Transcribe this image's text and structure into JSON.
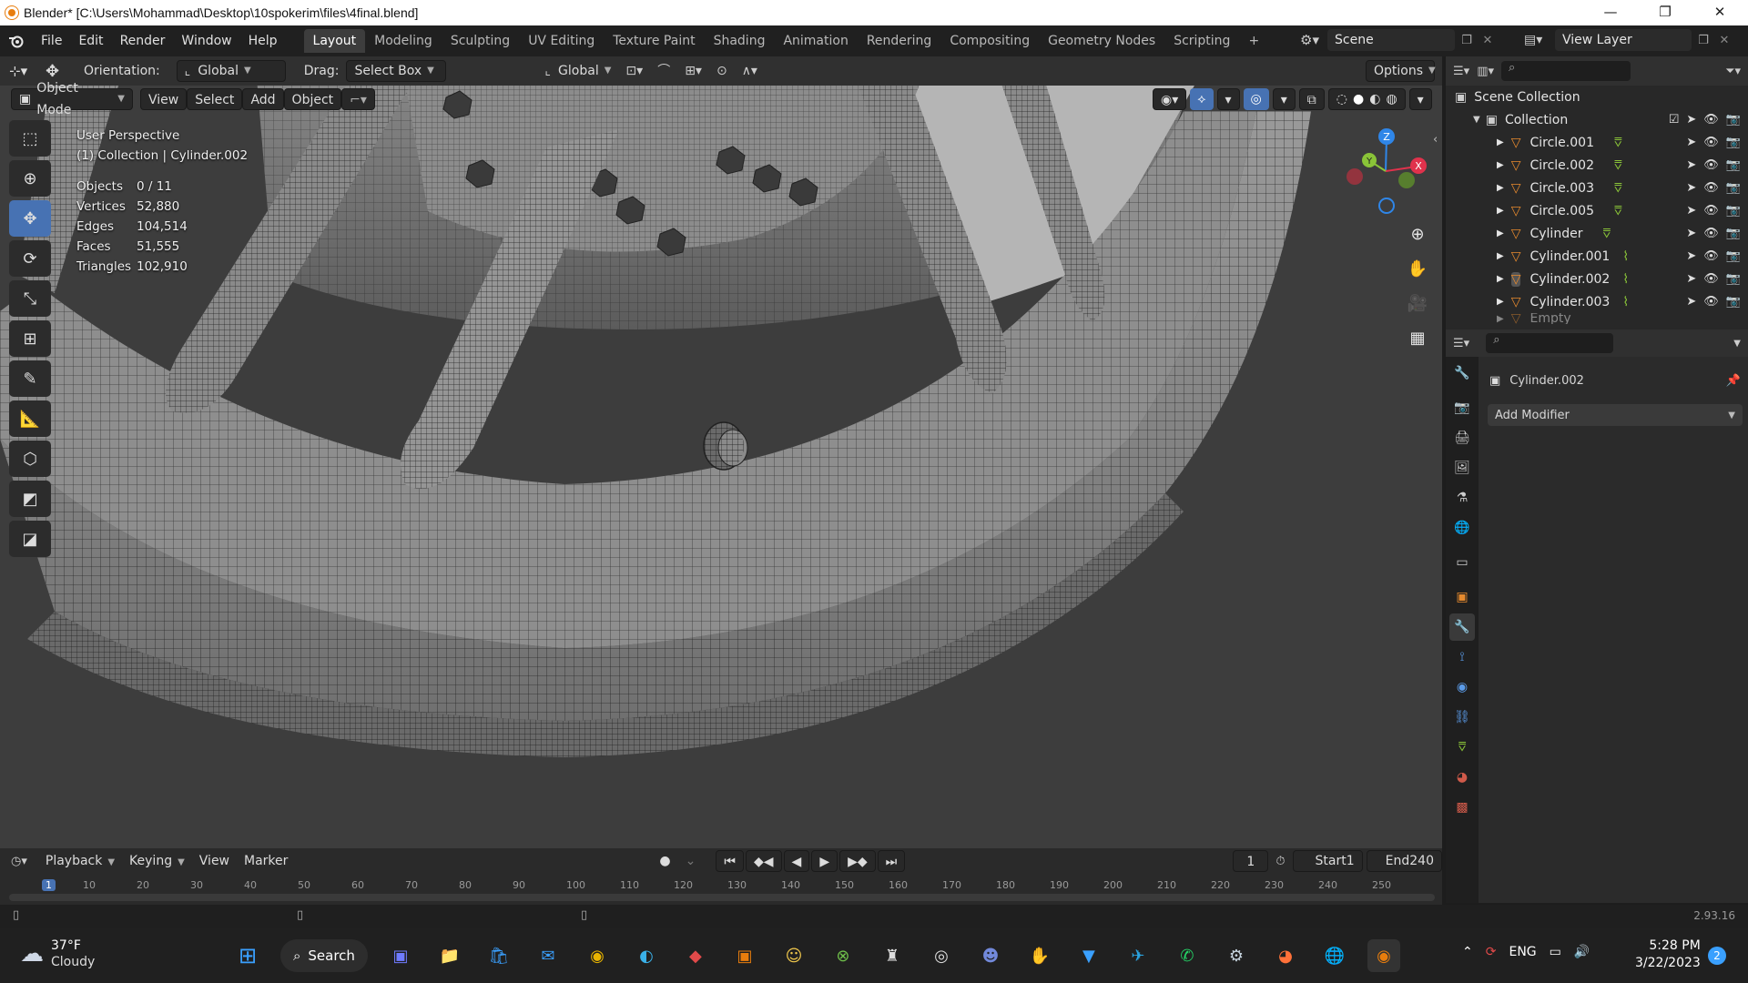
{
  "window": {
    "title": "Blender* [C:\\Users\\Mohammad\\Desktop\\10spokerim\\files\\4final.blend]",
    "minimize": "—",
    "maximize": "❐",
    "close": "✕"
  },
  "menubar": {
    "menus": [
      "File",
      "Edit",
      "Render",
      "Window",
      "Help"
    ],
    "workspaces": [
      "Layout",
      "Modeling",
      "Sculpting",
      "UV Editing",
      "Texture Paint",
      "Shading",
      "Animation",
      "Rendering",
      "Compositing",
      "Geometry Nodes",
      "Scripting"
    ],
    "active_workspace": "Layout",
    "add_tab": "+",
    "scene": "Scene",
    "view_layer": "View Layer"
  },
  "tool_header": {
    "orientation_label": "Orientation:",
    "orientation_value": "Global",
    "drag_label": "Drag:",
    "drag_value": "Select Box",
    "transform_orientation": "Global",
    "options": "Options"
  },
  "mode_header": {
    "mode": "Object Mode",
    "menus": [
      "View",
      "Select",
      "Add",
      "Object"
    ]
  },
  "viewport": {
    "perspective": "User Perspective",
    "collection_info": "(1) Collection | Cylinder.002",
    "stats": [
      {
        "key": "Objects",
        "value": "0 / 11"
      },
      {
        "key": "Vertices",
        "value": "52,880"
      },
      {
        "key": "Edges",
        "value": "104,514"
      },
      {
        "key": "Faces",
        "value": "51,555"
      },
      {
        "key": "Triangles",
        "value": "102,910"
      }
    ],
    "gizmo": {
      "x": "X",
      "y": "Y",
      "z": "Z"
    }
  },
  "outliner": {
    "scene_collection": "Scene Collection",
    "collection": "Collection",
    "items": [
      "Circle.001",
      "Circle.002",
      "Circle.003",
      "Circle.005",
      "Cylinder",
      "Cylinder.001",
      "Cylinder.002",
      "Cylinder.003",
      "Empty"
    ]
  },
  "properties": {
    "object_name": "Cylinder.002",
    "add_modifier": "Add Modifier"
  },
  "timeline": {
    "menus": [
      "Playback",
      "Keying",
      "View",
      "Marker"
    ],
    "current_frame": "1",
    "start_label": "Start",
    "start_value": "1",
    "end_label": "End",
    "end_value": "240",
    "ticks": [
      "10",
      "20",
      "30",
      "40",
      "50",
      "60",
      "70",
      "80",
      "90",
      "100",
      "110",
      "120",
      "130",
      "140",
      "150",
      "160",
      "170",
      "180",
      "190",
      "200",
      "210",
      "220",
      "230",
      "240",
      "250"
    ]
  },
  "statusbar": {
    "version": "2.93.16"
  },
  "taskbar": {
    "weather_temp": "37°F",
    "weather_desc": "Cloudy",
    "search": "Search",
    "language": "ENG",
    "time": "5:28 PM",
    "date": "3/22/2023",
    "notifications": "2"
  },
  "colors": {
    "accent": "#4772b3",
    "blender_orange": "#e87d0d",
    "object_orange": "#e68a2e",
    "axis_x": "#e0324c",
    "axis_y": "#8ac438",
    "axis_z": "#2f86e8"
  }
}
